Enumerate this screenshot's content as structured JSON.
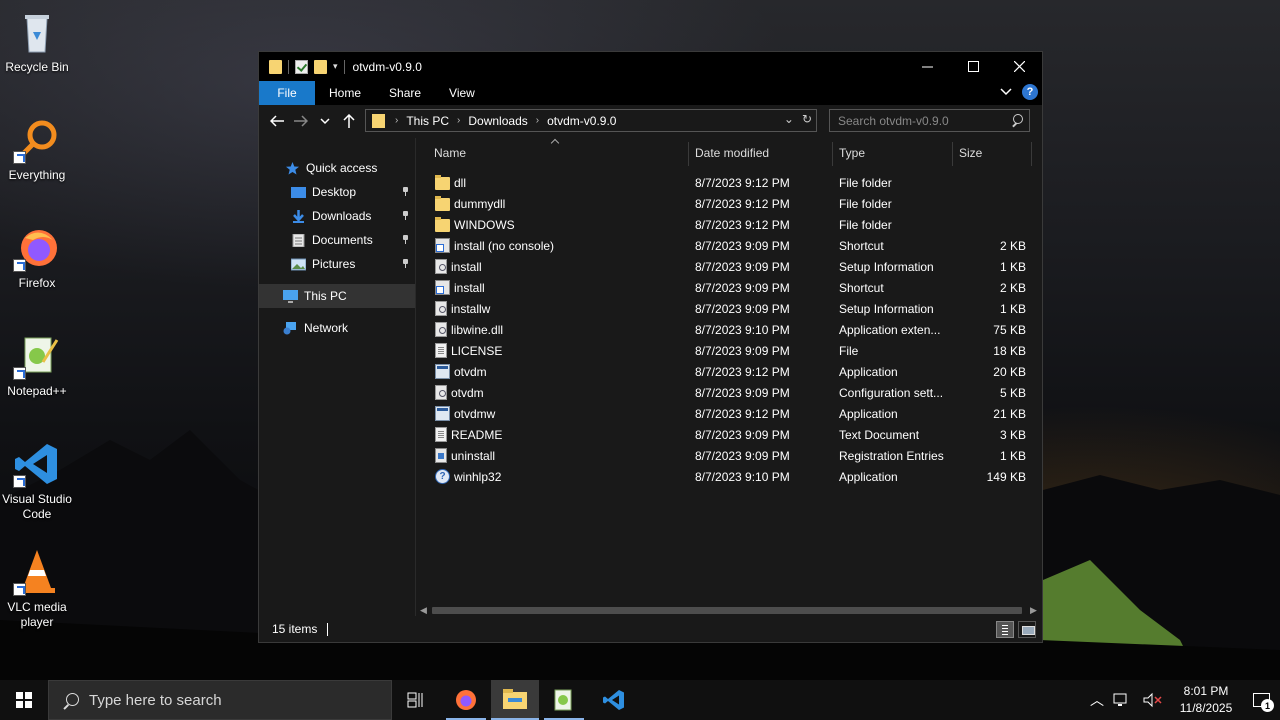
{
  "desktop": {
    "icons": [
      {
        "label": "Recycle Bin",
        "icon": "recycle-bin-icon"
      },
      {
        "label": "Everything",
        "icon": "everything-search-icon"
      },
      {
        "label": "Firefox",
        "icon": "firefox-icon"
      },
      {
        "label": "Notepad++",
        "icon": "notepad-plus-plus-icon"
      },
      {
        "label": "Visual Studio Code",
        "icon": "vscode-icon"
      },
      {
        "label": "VLC media player",
        "icon": "vlc-icon"
      }
    ]
  },
  "window": {
    "title": "otvdm-v0.9.0",
    "ribbon_tabs": [
      "File",
      "Home",
      "Share",
      "View"
    ],
    "address": {
      "crumbs": [
        "This PC",
        "Downloads",
        "otvdm-v0.9.0"
      ]
    },
    "search_placeholder": "Search otvdm-v0.9.0",
    "nav": {
      "quick_access": "Quick access",
      "items": [
        {
          "label": "Desktop",
          "icon": "desktop-folder-icon",
          "pinned": true
        },
        {
          "label": "Downloads",
          "icon": "downloads-folder-icon",
          "pinned": true
        },
        {
          "label": "Documents",
          "icon": "documents-folder-icon",
          "pinned": true
        },
        {
          "label": "Pictures",
          "icon": "pictures-folder-icon",
          "pinned": true
        }
      ],
      "this_pc": "This PC",
      "network": "Network"
    },
    "columns": {
      "name": "Name",
      "date": "Date modified",
      "type": "Type",
      "size": "Size"
    },
    "files": [
      {
        "name": "dll",
        "date": "8/7/2023 9:12 PM",
        "type": "File folder",
        "size": "",
        "icon": "folder"
      },
      {
        "name": "dummydll",
        "date": "8/7/2023 9:12 PM",
        "type": "File folder",
        "size": "",
        "icon": "folder"
      },
      {
        "name": "WINDOWS",
        "date": "8/7/2023 9:12 PM",
        "type": "File folder",
        "size": "",
        "icon": "folder"
      },
      {
        "name": "install (no console)",
        "date": "8/7/2023 9:09 PM",
        "type": "Shortcut",
        "size": "2 KB",
        "icon": "short"
      },
      {
        "name": "install",
        "date": "8/7/2023 9:09 PM",
        "type": "Setup Information",
        "size": "1 KB",
        "icon": "gear"
      },
      {
        "name": "install",
        "date": "8/7/2023 9:09 PM",
        "type": "Shortcut",
        "size": "2 KB",
        "icon": "short"
      },
      {
        "name": "installw",
        "date": "8/7/2023 9:09 PM",
        "type": "Setup Information",
        "size": "1 KB",
        "icon": "gear"
      },
      {
        "name": "libwine.dll",
        "date": "8/7/2023 9:10 PM",
        "type": "Application exten...",
        "size": "75 KB",
        "icon": "gear"
      },
      {
        "name": "LICENSE",
        "date": "8/7/2023 9:09 PM",
        "type": "File",
        "size": "18 KB",
        "icon": "doc"
      },
      {
        "name": "otvdm",
        "date": "8/7/2023 9:12 PM",
        "type": "Application",
        "size": "20 KB",
        "icon": "app"
      },
      {
        "name": "otvdm",
        "date": "8/7/2023 9:09 PM",
        "type": "Configuration sett...",
        "size": "5 KB",
        "icon": "gear"
      },
      {
        "name": "otvdmw",
        "date": "8/7/2023 9:12 PM",
        "type": "Application",
        "size": "21 KB",
        "icon": "app"
      },
      {
        "name": "README",
        "date": "8/7/2023 9:09 PM",
        "type": "Text Document",
        "size": "3 KB",
        "icon": "doc"
      },
      {
        "name": "uninstall",
        "date": "8/7/2023 9:09 PM",
        "type": "Registration Entries",
        "size": "1 KB",
        "icon": "reg"
      },
      {
        "name": "winhlp32",
        "date": "8/7/2023 9:10 PM",
        "type": "Application",
        "size": "149 KB",
        "icon": "help"
      }
    ],
    "status": "15 items"
  },
  "taskbar": {
    "search_placeholder": "Type here to search",
    "time": "8:01 PM",
    "date": "11/8/2025",
    "notification_count": "1"
  },
  "colors": {
    "accent": "#1979ca",
    "folder": "#f7d472"
  }
}
